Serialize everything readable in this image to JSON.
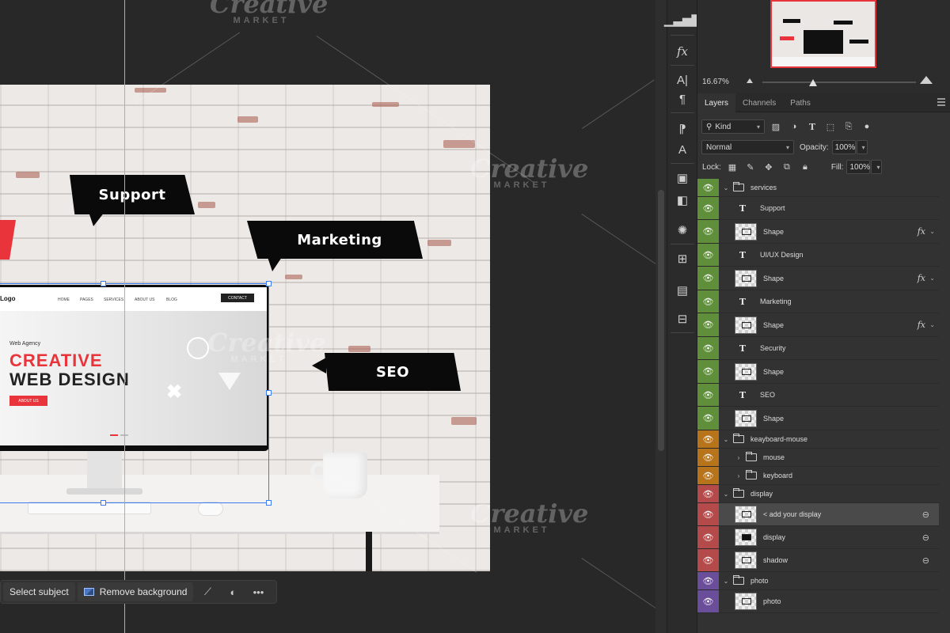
{
  "document": {
    "bubbles": [
      "Support",
      "Marketing",
      "SEO"
    ],
    "site": {
      "logo": "Logo",
      "nav_links": [
        "HOME",
        "PAGES",
        "SERVICES",
        "ABOUT US",
        "BLOG"
      ],
      "contact": "CONTACT",
      "kicker": "Web Agency",
      "headline_1": "CREATIVE",
      "headline_2": "WEB DESIGN",
      "button": "ABOUT US"
    }
  },
  "watermark": {
    "brand": "Creative",
    "sub": "MARKET"
  },
  "taskbar": {
    "select_subject": "Select subject",
    "remove_background": "Remove background",
    "icons": [
      "transform-icon",
      "mask-icon",
      "more-icon"
    ]
  },
  "navigator": {
    "zoom": "16.67%",
    "zoom_level": 0.33
  },
  "panel": {
    "tabs": [
      "Layers",
      "Channels",
      "Paths"
    ],
    "active_tab": "Layers",
    "filter_kind": "Kind",
    "blend_mode": "Normal",
    "opacity_label": "Opacity:",
    "opacity_value": "100%",
    "lock_label": "Lock:",
    "fill_label": "Fill:",
    "fill_value": "100%"
  },
  "layers": [
    {
      "name": "services",
      "type": "group",
      "expanded": true,
      "color": "#5f8f3a"
    },
    {
      "name": "Support",
      "type": "text",
      "color": "#5f8f3a"
    },
    {
      "name": "Shape",
      "type": "shape",
      "fx": true,
      "color": "#5f8f3a"
    },
    {
      "name": "UI/UX Design",
      "type": "text",
      "color": "#5f8f3a"
    },
    {
      "name": "Shape",
      "type": "shape",
      "fx": true,
      "color": "#5f8f3a"
    },
    {
      "name": "Marketing",
      "type": "text",
      "color": "#5f8f3a"
    },
    {
      "name": "Shape",
      "type": "shape",
      "fx": true,
      "color": "#5f8f3a"
    },
    {
      "name": "Security",
      "type": "text",
      "color": "#5f8f3a"
    },
    {
      "name": "Shape",
      "type": "shape",
      "color": "#5f8f3a"
    },
    {
      "name": "SEO",
      "type": "text",
      "color": "#5f8f3a"
    },
    {
      "name": "Shape",
      "type": "shape",
      "color": "#5f8f3a"
    },
    {
      "name": "keayboard-mouse",
      "type": "group",
      "expanded": true,
      "color": "#b7741b"
    },
    {
      "name": "mouse",
      "type": "group",
      "expanded": false,
      "color": "#b7741b"
    },
    {
      "name": "keyboard",
      "type": "group",
      "expanded": false,
      "color": "#b7741b"
    },
    {
      "name": "display",
      "type": "group",
      "expanded": true,
      "color": "#b54a4a"
    },
    {
      "name": "< add your display",
      "type": "smart",
      "link": true,
      "selected": true,
      "color": "#b54a4a"
    },
    {
      "name": "display",
      "type": "layer",
      "link": true,
      "color": "#b54a4a"
    },
    {
      "name": "shadow",
      "type": "layer",
      "link": true,
      "color": "#b54a4a"
    },
    {
      "name": "photo",
      "type": "group",
      "expanded": true,
      "color": "#6a4e99"
    },
    {
      "name": "photo",
      "type": "layer",
      "color": "#6a4e99"
    }
  ],
  "colors": {
    "accent": "#e8343a",
    "selection": "#3b7df0",
    "guide": "#4fd3e0"
  }
}
